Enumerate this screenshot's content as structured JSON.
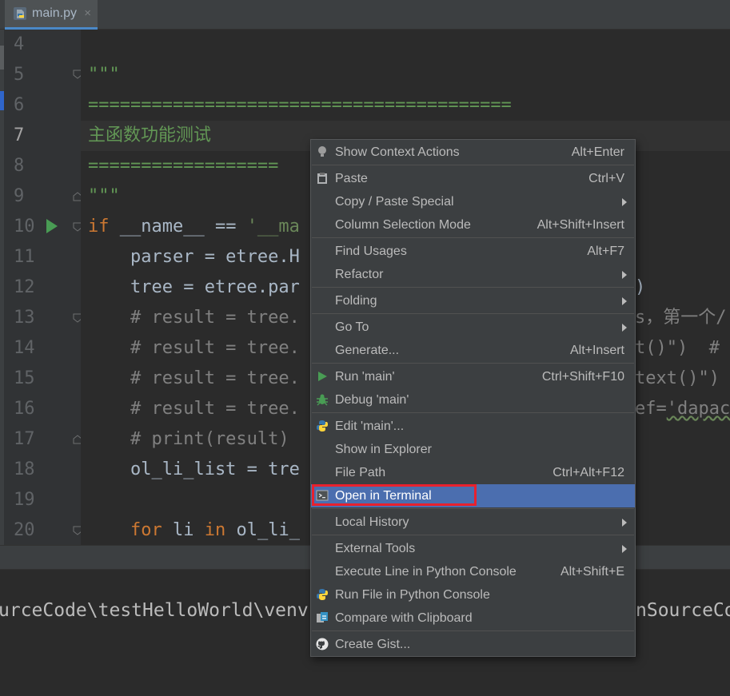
{
  "tab": {
    "filename": "main.py",
    "close_glyph": "×",
    "icon": "python-file-icon"
  },
  "gutter": {
    "line_numbers": [
      "4",
      "5",
      "6",
      "7",
      "8",
      "9",
      "10",
      "11",
      "12",
      "13",
      "14",
      "15",
      "16",
      "17",
      "18",
      "19",
      "20"
    ],
    "current_line": "7"
  },
  "code": {
    "l4": "",
    "l5": "\"\"\"",
    "l6": "========================================",
    "l7": "主函数功能测试",
    "l8": "==================",
    "l9": "\"\"\"",
    "l10_kw": "if",
    "l10_rest": " __name__ == ",
    "l10_str": "'__ma",
    "l11": "    parser = etree.H",
    "l12": "    tree = etree.par",
    "l12_right": ")",
    "l13": "    # result = tree.",
    "l13_right": "s，第一个/",
    "l14": "    # result = tree.",
    "l14_right": "t()\")  #",
    "l15": "    # result = tree.",
    "l15_right": "text()\")",
    "l16": "    # result = tree.",
    "l16_right_a": "ef=",
    "l16_right_b": "'dapac",
    "l17": "    # print(result)",
    "l18": "    ol_li_list = tre",
    "l20_a": "    ",
    "l20_kw1": "for",
    "l20_b": " li ",
    "l20_kw2": "in",
    "l20_c": " ol_li_"
  },
  "terminal": {
    "text": "urceCode\\testHelloWorld\\venv",
    "text_right": "nSourceCo"
  },
  "menu": {
    "items": [
      {
        "label": "Show Context Actions",
        "shortcut": "Alt+Enter",
        "icon": "lightbulb-icon"
      },
      {
        "label": "Paste",
        "shortcut": "Ctrl+V",
        "icon": "clipboard-icon"
      },
      {
        "label": "Copy / Paste Special",
        "shortcut": "",
        "submenu": true
      },
      {
        "label": "Column Selection Mode",
        "shortcut": "Alt+Shift+Insert"
      },
      {
        "label": "Find Usages",
        "shortcut": "Alt+F7"
      },
      {
        "label": "Refactor",
        "shortcut": "",
        "submenu": true
      },
      {
        "label": "Folding",
        "shortcut": "",
        "submenu": true
      },
      {
        "label": "Go To",
        "shortcut": "",
        "submenu": true
      },
      {
        "label": "Generate...",
        "shortcut": "Alt+Insert"
      },
      {
        "label": "Run 'main'",
        "shortcut": "Ctrl+Shift+F10",
        "icon": "run-icon"
      },
      {
        "label": "Debug 'main'",
        "shortcut": "",
        "icon": "debug-bug-icon"
      },
      {
        "label": "Edit 'main'...",
        "shortcut": "",
        "icon": "python-icon"
      },
      {
        "label": "Show in Explorer",
        "shortcut": ""
      },
      {
        "label": "File Path",
        "shortcut": "Ctrl+Alt+F12"
      },
      {
        "label": "Open in Terminal",
        "shortcut": "",
        "icon": "terminal-icon",
        "selected": true
      },
      {
        "label": "Local History",
        "shortcut": "",
        "submenu": true
      },
      {
        "label": "External Tools",
        "shortcut": "",
        "submenu": true
      },
      {
        "label": "Execute Line in Python Console",
        "shortcut": "Alt+Shift+E"
      },
      {
        "label": "Run File in Python Console",
        "shortcut": "",
        "icon": "python-icon"
      },
      {
        "label": "Compare with Clipboard",
        "shortcut": "",
        "icon": "compare-icon"
      },
      {
        "label": "Create Gist...",
        "shortcut": "",
        "icon": "github-icon"
      }
    ]
  },
  "colors": {
    "selection": "#4b6eaf",
    "highlight_box": "#e8212e",
    "run_green": "#499c54"
  }
}
